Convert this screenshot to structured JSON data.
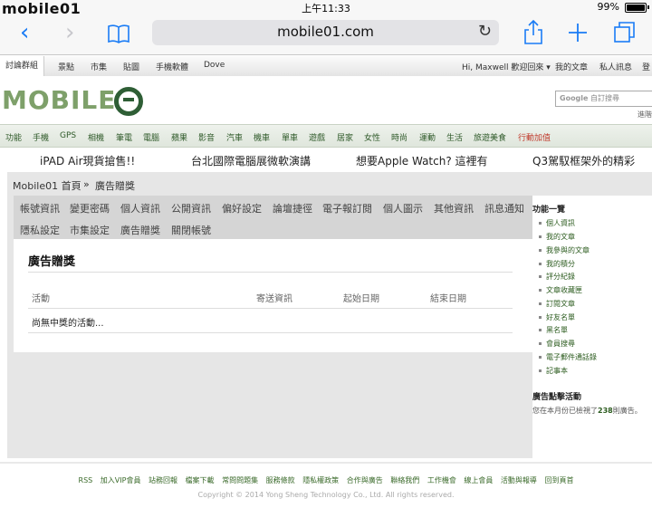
{
  "statusbar": {
    "time": "上午11:33",
    "battery": "99%",
    "watermark": "mobile01"
  },
  "browser": {
    "url": "mobile01.com",
    "icons": [
      "back-icon",
      "forward-icon",
      "bookmarks-icon",
      "reload-icon",
      "share-icon",
      "add-tab-icon",
      "tabs-icon"
    ]
  },
  "topnav": {
    "items": [
      "討論群組",
      "景點",
      "市集",
      "貼圖",
      "手機軟體",
      "Dove"
    ],
    "user": "Hi, Maxwell 歡迎回來 ▾",
    "right_items": [
      "我的文章",
      "私人訊息",
      "登"
    ]
  },
  "logo": {
    "text": "MOBILE"
  },
  "search": {
    "placeholder_brand": "Google",
    "placeholder": "自訂搜尋",
    "side_text": "進階"
  },
  "categories": [
    "功能",
    "手機",
    "GPS",
    "相機",
    "筆電",
    "電腦",
    "蘋果",
    "影音",
    "汽車",
    "機車",
    "單車",
    "遊戲",
    "居家",
    "女性",
    "時尚",
    "運動",
    "生活",
    "旅遊美食",
    "行動加值"
  ],
  "adlinks": [
    "iPAD Air現貨搶售!!",
    "台北國際電腦展微軟演講",
    "想要Apple Watch? 這裡有",
    "Q3駕馭框架外的精彩"
  ],
  "breadcrumb": {
    "home": "Mobile01 首頁",
    "sep": "»",
    "current": "廣告贈獎"
  },
  "tabs_row1": [
    "帳號資訊",
    "變更密碼",
    "個人資訊",
    "公開資訊",
    "偏好設定",
    "論壇捷徑",
    "電子報訂閱",
    "個人圖示",
    "其他資訊",
    "訊息通知"
  ],
  "tabs_row2": [
    "隱私設定",
    "市集設定",
    "廣告贈獎",
    "關閉帳號"
  ],
  "panel": {
    "title": "廣告贈獎",
    "headers": [
      "活動",
      "寄送資訊",
      "起始日期",
      "結束日期"
    ],
    "empty": "尚無中獎的活動..."
  },
  "sidebar": {
    "title": "功能一覽",
    "items": [
      "個人資訊",
      "我的文章",
      "我參與的文章",
      "我的積分",
      "評分紀錄",
      "文章收藏匣",
      "訂閱文章",
      "好友名單",
      "黑名單",
      "會員搜尋",
      "電子郵件通話錄",
      "記事本"
    ],
    "ad_title": "廣告點擊活動",
    "ad_note_prefix": "您在本月份已檢視了",
    "ad_note_count": "238",
    "ad_note_suffix": "則廣告。"
  },
  "footer": {
    "links": [
      "RSS",
      "加入VIP會員",
      "站務回報",
      "檔案下載",
      "常問問題集",
      "服務條款",
      "隱私權政策",
      "合作與廣告",
      "聯絡我們",
      "工作機會",
      "線上會員",
      "活動與報導",
      "回到頁首"
    ],
    "copyright": "Copyright © 2014 Yong Sheng Technology Co., Ltd. All rights reserved."
  }
}
